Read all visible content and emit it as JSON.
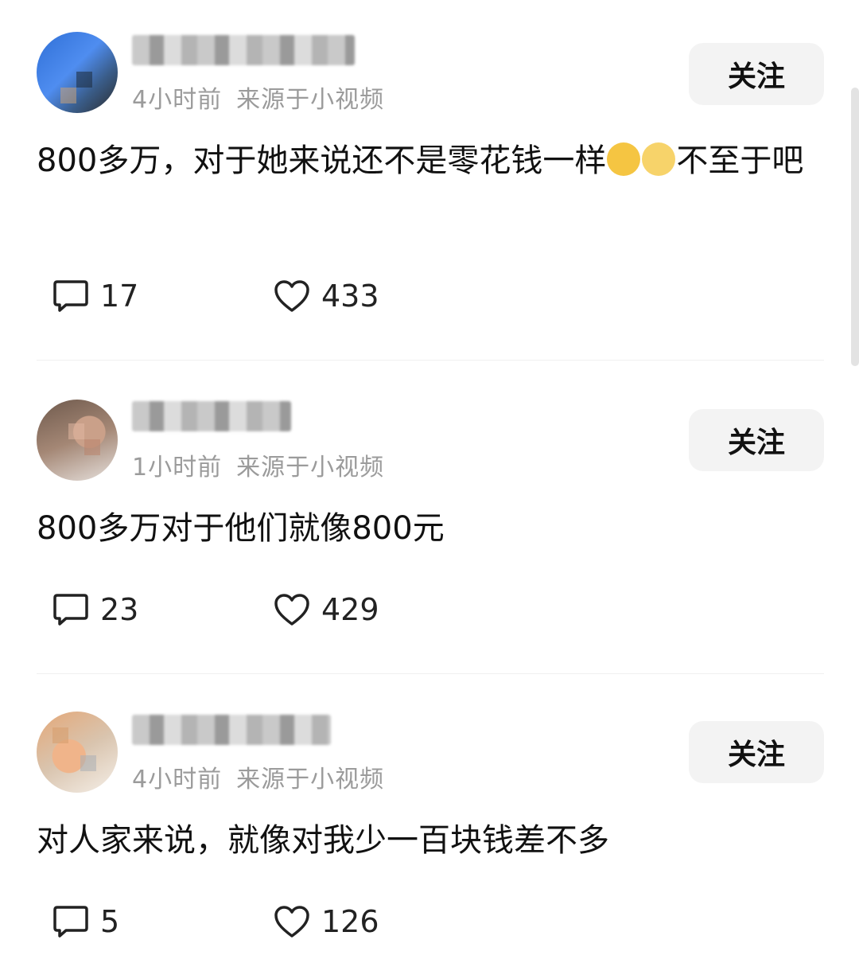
{
  "comments": [
    {
      "time": "4小时前",
      "source": "来源于小视频",
      "follow_label": "关注",
      "text_before_emoji": "800多万，对于她来说还不是零花钱一样",
      "emojis": [
        "grinning-sweat-emoji",
        "flushed-emoji"
      ],
      "text_after_emoji": "不至于吧",
      "reply_count": "17",
      "like_count": "433"
    },
    {
      "time": "1小时前",
      "source": "来源于小视频",
      "follow_label": "关注",
      "text": "800多万对于他们就像800元",
      "reply_count": "23",
      "like_count": "429"
    },
    {
      "time": "4小时前",
      "source": "来源于小视频",
      "follow_label": "关注",
      "text": "对人家来说，就像对我少一百块钱差不多",
      "reply_count": "5",
      "like_count": "126"
    }
  ]
}
